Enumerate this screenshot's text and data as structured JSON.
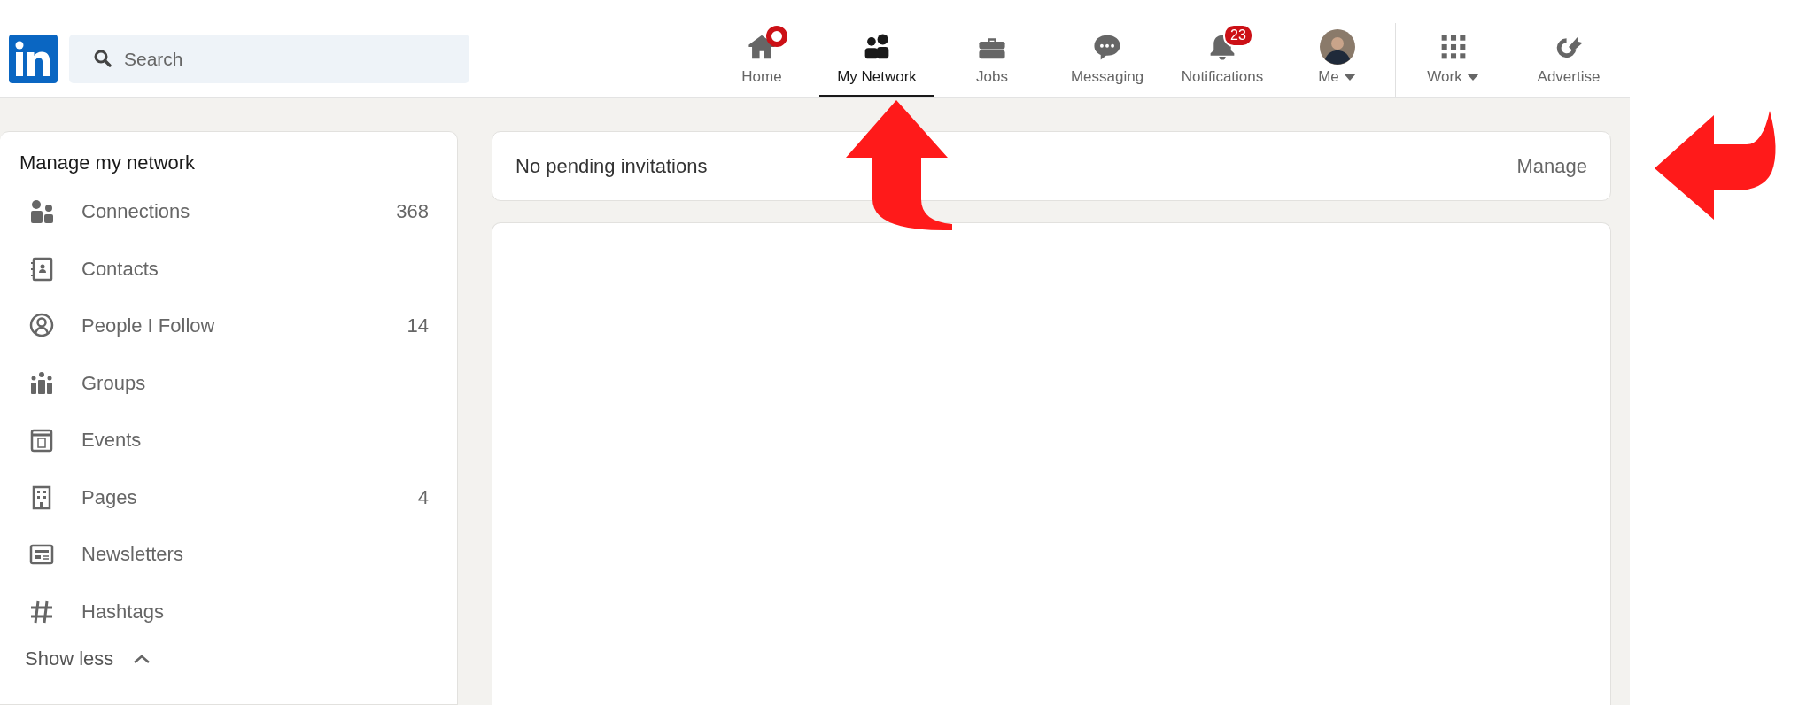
{
  "search": {
    "placeholder": "Search"
  },
  "nav": [
    {
      "label": "Home",
      "selected": false,
      "dot": true
    },
    {
      "label": "My Network",
      "selected": true
    },
    {
      "label": "Jobs",
      "selected": false
    },
    {
      "label": "Messaging",
      "selected": false
    },
    {
      "label": "Notifications",
      "selected": false,
      "badge": "23"
    },
    {
      "label": "Me",
      "selected": false,
      "caret": true
    },
    {
      "label": "Work",
      "selected": false,
      "caret": true
    },
    {
      "label": "Advertise",
      "selected": false
    }
  ],
  "sidebar": {
    "title": "Manage my network",
    "items": [
      {
        "label": "Connections",
        "count": "368"
      },
      {
        "label": "Contacts"
      },
      {
        "label": "People I Follow",
        "count": "14"
      },
      {
        "label": "Groups"
      },
      {
        "label": "Events"
      },
      {
        "label": "Pages",
        "count": "4"
      },
      {
        "label": "Newsletters"
      },
      {
        "label": "Hashtags"
      }
    ],
    "toggle": "Show less"
  },
  "invitations": {
    "text": "No pending invitations",
    "action": "Manage"
  }
}
